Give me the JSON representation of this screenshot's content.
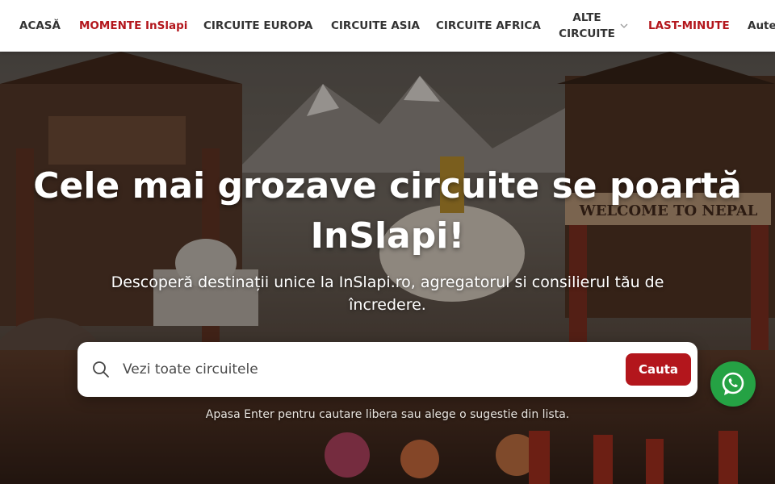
{
  "nav": {
    "items": [
      {
        "label": "ACASĂ",
        "active": false
      },
      {
        "label": "MOMENTE InSlapi",
        "active": true
      },
      {
        "label": "CIRCUITE EUROPA",
        "active": false
      },
      {
        "label": "CIRCUITE ASIA",
        "active": false
      },
      {
        "label": "CIRCUITE AFRICA",
        "active": false
      },
      {
        "label_line1": "ALTE",
        "label_line2": "CIRCUITE",
        "has_dropdown": true
      },
      {
        "label": "LAST-MINUTE",
        "highlight": true
      },
      {
        "label": "Autentificare",
        "visible_text": "Aute"
      }
    ],
    "dropdown_icon": "chevron-down-icon"
  },
  "hero": {
    "title_line1": "Cele mai grozave circuite se poartă",
    "title_line2": "InSlapi!",
    "subtitle": "Descoperă destinații unice la InSlapi.ro, agregatorul si consilierul tău de încredere.",
    "background_sign": "WELCOME TO NEPAL"
  },
  "search": {
    "icon": "search-icon",
    "placeholder": "Vezi toate circuitele",
    "value": "",
    "button_label": "Cauta",
    "hint": "Apasa Enter pentru cautare libera sau alege o sugestie din lista."
  },
  "floating": {
    "whatsapp_icon": "whatsapp-icon"
  },
  "colors": {
    "accent": "#b3161c",
    "nav_text": "#333333",
    "whatsapp": "#25a244"
  }
}
